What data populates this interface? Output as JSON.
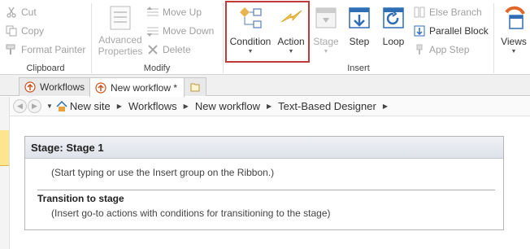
{
  "ribbon": {
    "clipboard": {
      "label": "Clipboard",
      "cut": "Cut",
      "copy": "Copy",
      "format_painter": "Format Painter"
    },
    "modify": {
      "label": "Modify",
      "advanced_properties_line1": "Advanced",
      "advanced_properties_line2": "Properties",
      "move_up": "Move Up",
      "move_down": "Move Down",
      "delete": "Delete"
    },
    "insert": {
      "label": "Insert",
      "condition": "Condition",
      "action": "Action",
      "stage": "Stage",
      "step": "Step",
      "loop": "Loop",
      "else_branch": "Else Branch",
      "parallel_block": "Parallel Block",
      "app_step": "App Step"
    },
    "views": "Views"
  },
  "tabs": [
    {
      "label": "Workflows",
      "icon": "workflow-icon"
    },
    {
      "label": "New workflow *",
      "icon": "workflow-icon"
    }
  ],
  "breadcrumb": [
    "New site",
    "Workflows",
    "New workflow",
    "Text-Based Designer"
  ],
  "stage": {
    "title": "Stage: Stage 1",
    "hint": "(Start typing or use the Insert group on the Ribbon.)",
    "transition_title": "Transition to stage",
    "transition_hint": "(Insert go-to actions with conditions for transitioning to the stage)"
  },
  "colors": {
    "highlight": "#c0393b",
    "accent_blue": "#2f6db5",
    "condition_diamond": "#e8b44c",
    "action_bolt": "#f0c24b"
  }
}
